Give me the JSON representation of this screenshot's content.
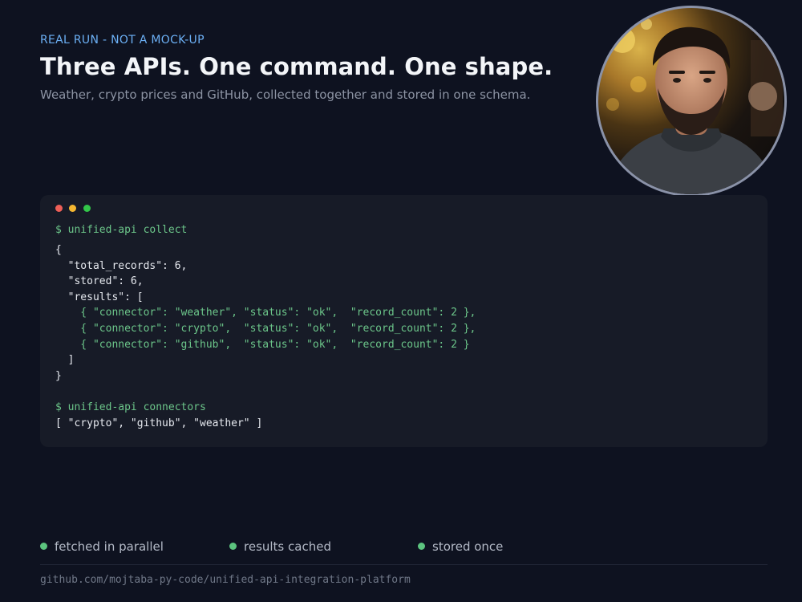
{
  "header": {
    "eyebrow": "REAL RUN - NOT A MOCK-UP",
    "title": "Three APIs. One command. One shape.",
    "subtitle": "Weather, crypto prices and GitHub, collected together and stored in one schema."
  },
  "avatar": {
    "icon": "profile-photo"
  },
  "terminal": {
    "dots": [
      "#ee5f57",
      "#f5b731",
      "#32c649"
    ],
    "command1": "$ unified-api collect",
    "output1_open": "{",
    "output1_total": "  \"total_records\": 6,",
    "output1_stored": "  \"stored\": 6,",
    "output1_results_open": "  \"results\": [",
    "output1_row1": "    { \"connector\": \"weather\", \"status\": \"ok\",  \"record_count\": 2 },",
    "output1_row2": "    { \"connector\": \"crypto\",  \"status\": \"ok\",  \"record_count\": 2 },",
    "output1_row3": "    { \"connector\": \"github\",  \"status\": \"ok\",  \"record_count\": 2 }",
    "output1_results_close": "  ]",
    "output1_close": "}",
    "command2": "$ unified-api connectors",
    "output2": "[ \"crypto\", \"github\", \"weather\" ]"
  },
  "features": [
    {
      "label": "fetched in parallel"
    },
    {
      "label": "results cached"
    },
    {
      "label": "stored once"
    }
  ],
  "footer": {
    "repo": "github.com/mojtaba-py-code/unified-api-integration-platform"
  },
  "colors": {
    "accent_blue": "#6cb0f5",
    "accent_green": "#5cc47f",
    "background": "#0e1220",
    "terminal_bg": "#171b27"
  }
}
